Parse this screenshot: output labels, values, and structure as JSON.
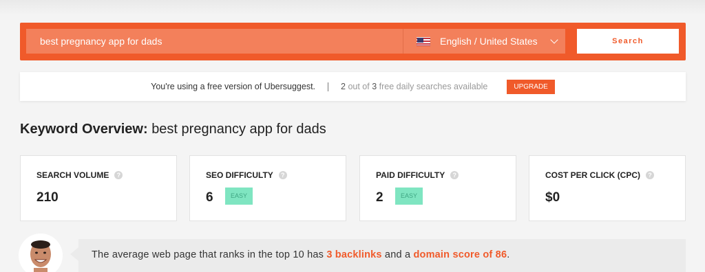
{
  "search": {
    "query": "best pregnancy app for dads",
    "language": "English / United States",
    "button_label": "Search"
  },
  "notice": {
    "message": "You're using a free version of Ubersuggest.",
    "used": "2",
    "out_of": "out of",
    "total": "3",
    "suffix": "free daily searches available",
    "upgrade_label": "UPGRADE"
  },
  "overview": {
    "title_prefix": "Keyword Overview:",
    "keyword": "best pregnancy app for dads"
  },
  "metrics": [
    {
      "label": "SEARCH VOLUME",
      "value": "210",
      "badge": ""
    },
    {
      "label": "SEO DIFFICULTY",
      "value": "6",
      "badge": "EASY"
    },
    {
      "label": "PAID DIFFICULTY",
      "value": "2",
      "badge": "EASY"
    },
    {
      "label": "COST PER CLICK (CPC)",
      "value": "$0",
      "badge": ""
    }
  ],
  "info_icon_glyph": "?",
  "tip": {
    "part1": "The average web page that ranks in the top 10 has ",
    "backlinks": "3 backlinks",
    "part2": " and a ",
    "domain_score": "domain score of 86",
    "part3": "."
  },
  "colors": {
    "accent": "#f05a2a",
    "easy_badge": "#7fe5c1"
  }
}
